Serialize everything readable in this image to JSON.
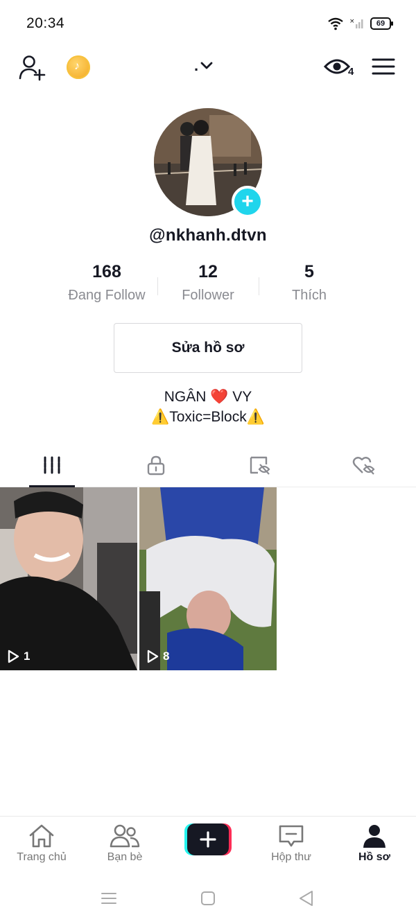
{
  "status": {
    "time": "20:34",
    "battery": "69"
  },
  "header": {
    "views_badge": "4"
  },
  "profile": {
    "handle": "@nkhanh.dtvn",
    "stats": [
      {
        "value": "168",
        "label": "Đang Follow"
      },
      {
        "value": "12",
        "label": "Follower"
      },
      {
        "value": "5",
        "label": "Thích"
      }
    ],
    "edit_label": "Sửa hồ sơ",
    "bio_line1": "NGÂN ❤️ VY",
    "bio_line2": "⚠️Toxic=Block⚠️"
  },
  "tabs": [
    {
      "icon": "grid-icon",
      "active": true
    },
    {
      "icon": "lock-icon",
      "active": false
    },
    {
      "icon": "tag-hidden-icon",
      "active": false
    },
    {
      "icon": "liked-hidden-icon",
      "active": false
    }
  ],
  "videos": [
    {
      "views": "1"
    },
    {
      "views": "8"
    }
  ],
  "nav": {
    "home": "Trang chủ",
    "friends": "Bạn bè",
    "inbox": "Hộp thư",
    "profile": "Hồ sơ"
  },
  "colors": {
    "accent_cyan": "#20d5ec",
    "accent_pink": "#fe2c55",
    "text": "#161823",
    "muted": "#8a8b91"
  }
}
